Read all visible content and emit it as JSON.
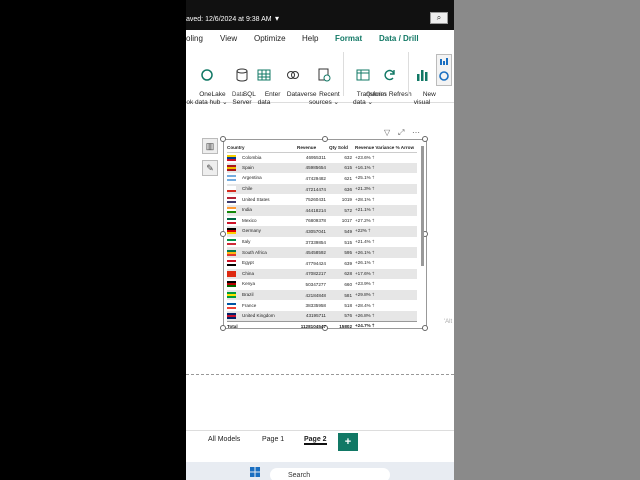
{
  "titlebar": {
    "saved": "aved: 12/6/2024 at 9:38 AM",
    "chevron": "▾",
    "search_glyph": "⌕"
  },
  "menu": [
    "oling",
    "View",
    "Optimize",
    "Help",
    "Format",
    "Data / Drill"
  ],
  "ribbon": {
    "items": [
      {
        "label": "OneLake\nok data hub ⌄"
      },
      {
        "label": "SQL\nServer"
      },
      {
        "label": "Enter\ndata"
      },
      {
        "label": "Dataverse"
      },
      {
        "label": "Recent\nsources ⌄"
      },
      {
        "label": "Transform\ndata ⌄"
      },
      {
        "label": "Refresh"
      },
      {
        "label": "New\nvisual"
      }
    ],
    "groups": [
      "Data",
      "Queries"
    ]
  },
  "visual_header_icons": [
    "filter-icon",
    "focus-mode-icon",
    "more-options-icon"
  ],
  "table": {
    "headers": [
      "Country",
      "Revenue",
      "Qty Sold",
      "Revenue Variance % Arrow"
    ],
    "rows": [
      {
        "country": "Colombia",
        "revenue": "46955311",
        "qty": "632",
        "variance": "+23.6% 🡑"
      },
      {
        "country": "Spain",
        "revenue": "45985654",
        "qty": "615",
        "variance": "+16.1% 🡑"
      },
      {
        "country": "Argentina",
        "revenue": "47429482",
        "qty": "621",
        "variance": "+25.1% 🡑"
      },
      {
        "country": "Chile",
        "revenue": "47214474",
        "qty": "636",
        "variance": "+21.3% 🡑"
      },
      {
        "country": "United States",
        "revenue": "75260431",
        "qty": "1019",
        "variance": "+28.1% 🡑"
      },
      {
        "country": "India",
        "revenue": "44418214",
        "qty": "572",
        "variance": "+21.1% 🡑"
      },
      {
        "country": "Mexico",
        "revenue": "76809378",
        "qty": "1017",
        "variance": "+27.2% 🡑"
      },
      {
        "country": "Germany",
        "revenue": "43057041",
        "qty": "549",
        "variance": "+22% 🡑"
      },
      {
        "country": "Italy",
        "revenue": "37339854",
        "qty": "515",
        "variance": "+21.4% 🡑"
      },
      {
        "country": "South Africa",
        "revenue": "45458592",
        "qty": "595",
        "variance": "+26.1% 🡑"
      },
      {
        "country": "Egypt",
        "revenue": "47794424",
        "qty": "639",
        "variance": "+26.1% 🡑"
      },
      {
        "country": "China",
        "revenue": "47082217",
        "qty": "628",
        "variance": "+17.6% 🡑"
      },
      {
        "country": "Kenya",
        "revenue": "50347277",
        "qty": "660",
        "variance": "+23.9% 🡑"
      },
      {
        "country": "Brazil",
        "revenue": "42184848",
        "qty": "581",
        "variance": "+29.8% 🡑"
      },
      {
        "country": "France",
        "revenue": "38335958",
        "qty": "518",
        "variance": "+28.4% 🡑"
      },
      {
        "country": "United Kingdom",
        "revenue": "43195711",
        "qty": "576",
        "variance": "+26.8% 🡑"
      }
    ],
    "total": {
      "label": "Total",
      "revenue": "1128104547",
      "qty": "15802",
      "variance": "+24.7% 🡑"
    },
    "flag_colors": [
      [
        "#f5d100",
        "#003893",
        "#ce1126"
      ],
      [
        "#aa151b",
        "#f1bf00",
        "#aa151b"
      ],
      [
        "#74acdf",
        "#ffffff",
        "#74acdf"
      ],
      [
        "#ffffff",
        "#ffffff",
        "#d52b1e"
      ],
      [
        "#b22234",
        "#ffffff",
        "#3c3b6e"
      ],
      [
        "#ff9933",
        "#ffffff",
        "#138808"
      ],
      [
        "#006847",
        "#ffffff",
        "#ce1126"
      ],
      [
        "#000000",
        "#dd0000",
        "#ffce00"
      ],
      [
        "#009246",
        "#ffffff",
        "#ce2b37"
      ],
      [
        "#007a4d",
        "#ffb612",
        "#de3831"
      ],
      [
        "#ce1126",
        "#ffffff",
        "#000000"
      ],
      [
        "#de2910",
        "#de2910",
        "#de2910"
      ],
      [
        "#000000",
        "#bb0000",
        "#006600"
      ],
      [
        "#009c3b",
        "#ffdf00",
        "#009c3b"
      ],
      [
        "#0055a4",
        "#ffffff",
        "#ef4135"
      ],
      [
        "#012169",
        "#c8102e",
        "#012169"
      ]
    ]
  },
  "side_label": "'Alt",
  "tabs": [
    "All Models",
    "Page 1",
    "Page 2"
  ],
  "add_tab": "+",
  "taskbar": {
    "search": "Search"
  },
  "colors": {
    "accent": "#117865"
  }
}
